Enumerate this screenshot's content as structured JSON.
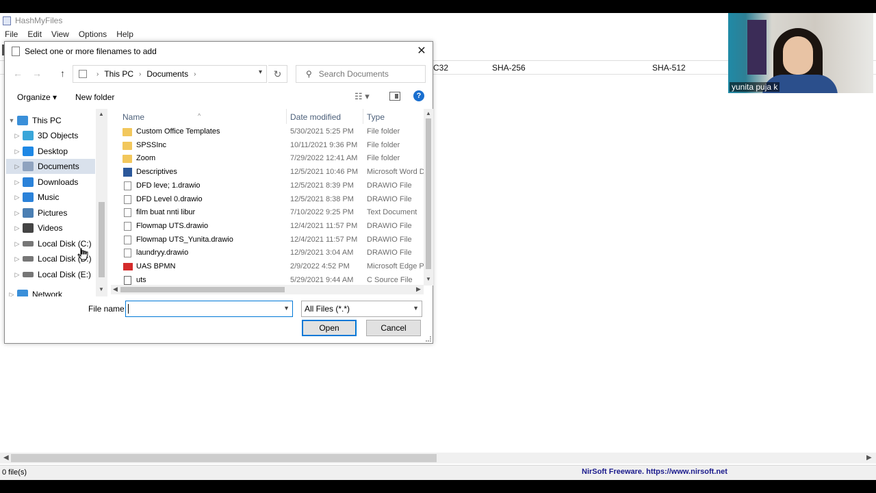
{
  "app": {
    "title": "HashMyFiles",
    "menu": [
      "File",
      "Edit",
      "View",
      "Options",
      "Help"
    ],
    "columns": {
      "crc": "C32",
      "sha256": "SHA-256",
      "sha512": "SHA-512"
    },
    "status_count": "0 file(s)",
    "status_credit": "NirSoft Freeware. https://www.nirsoft.net"
  },
  "webcam": {
    "name": "yunita puja k"
  },
  "dialog": {
    "title": "Select one or more filenames to add",
    "breadcrumb": [
      "This PC",
      "Documents"
    ],
    "search_placeholder": "Search Documents",
    "organize_label": "Organize",
    "new_folder_label": "New folder",
    "help_label": "?",
    "nav_items": [
      {
        "label": "This PC",
        "icon": "computer-icon",
        "color": "#3a8fd9"
      },
      {
        "label": "3D Objects",
        "icon": "cube-icon",
        "color": "#3aa6d9"
      },
      {
        "label": "Desktop",
        "icon": "desktop-icon",
        "color": "#1e88e5"
      },
      {
        "label": "Documents",
        "icon": "documents-icon",
        "color": "#8fa3bf"
      },
      {
        "label": "Downloads",
        "icon": "download-icon",
        "color": "#2b82d9"
      },
      {
        "label": "Music",
        "icon": "music-icon",
        "color": "#2b82d9"
      },
      {
        "label": "Pictures",
        "icon": "pictures-icon",
        "color": "#4b7fb3"
      },
      {
        "label": "Videos",
        "icon": "videos-icon",
        "color": "#444"
      },
      {
        "label": "Local Disk (C:)",
        "icon": "disk-icon",
        "color": "#777"
      },
      {
        "label": "Local Disk (D:)",
        "icon": "disk-icon",
        "color": "#777"
      },
      {
        "label": "Local Disk (E:)",
        "icon": "disk-icon",
        "color": "#777"
      },
      {
        "label": "Network",
        "icon": "network-icon",
        "color": "#3a8fd9"
      }
    ],
    "columns": {
      "name": "Name",
      "date": "Date modified",
      "type": "Type"
    },
    "files": [
      {
        "name": "Custom Office Templates",
        "date": "5/30/2021 5:25 PM",
        "type": "File folder",
        "icon": "folder"
      },
      {
        "name": "SPSSInc",
        "date": "10/11/2021 9:36 PM",
        "type": "File folder",
        "icon": "folder"
      },
      {
        "name": "Zoom",
        "date": "7/29/2022 12:41 AM",
        "type": "File folder",
        "icon": "folder"
      },
      {
        "name": "Descriptives",
        "date": "12/5/2021 10:46 PM",
        "type": "Microsoft Word D",
        "icon": "word"
      },
      {
        "name": "DFD leve; 1.drawio",
        "date": "12/5/2021 8:39 PM",
        "type": "DRAWIO File",
        "icon": "file"
      },
      {
        "name": "DFD Level 0.drawio",
        "date": "12/5/2021 8:38 PM",
        "type": "DRAWIO File",
        "icon": "file"
      },
      {
        "name": "film buat nnti libur",
        "date": "7/10/2022 9:25 PM",
        "type": "Text Document",
        "icon": "file"
      },
      {
        "name": "Flowmap UTS.drawio",
        "date": "12/4/2021 11:57 PM",
        "type": "DRAWIO File",
        "icon": "file"
      },
      {
        "name": "Flowmap UTS_Yunita.drawio",
        "date": "12/4/2021 11:57 PM",
        "type": "DRAWIO File",
        "icon": "file"
      },
      {
        "name": "laundryy.drawio",
        "date": "12/9/2021 3:04 AM",
        "type": "DRAWIO File",
        "icon": "file"
      },
      {
        "name": "UAS BPMN",
        "date": "2/9/2022 4:52 PM",
        "type": "Microsoft Edge P...",
        "icon": "pdf"
      },
      {
        "name": "uts",
        "date": "5/29/2021 9:44 AM",
        "type": "C Source File",
        "icon": "c"
      }
    ],
    "filename_label": "File name:",
    "filename_value": "",
    "filter_value": "All Files (*.*)",
    "open_label": "Open",
    "cancel_label": "Cancel"
  }
}
